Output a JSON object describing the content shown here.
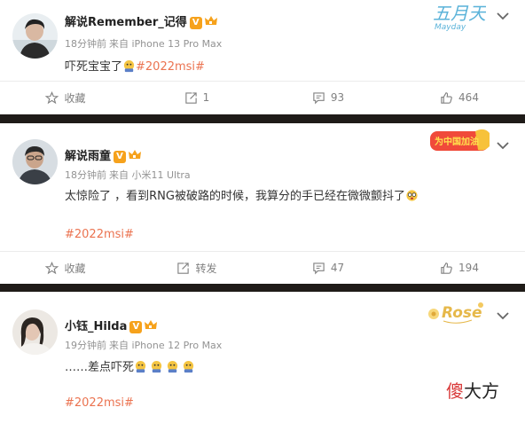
{
  "posts": [
    {
      "username": "解说Remember_记得",
      "v_badge": "V",
      "time": "18分钟前",
      "source": "来自 iPhone 13 Pro Max",
      "text": "吓死宝宝了",
      "hashtag": "#2022msi#",
      "actions": {
        "favorite": "收藏",
        "repost": "1",
        "comment": "93",
        "like": "464"
      },
      "decoration": "五月天 Mayday"
    },
    {
      "username": "解说雨童",
      "v_badge": "V",
      "time": "18分钟前",
      "source": "来自 小米11 Ultra",
      "text": "太惊险了 ，看到RNG被破路的时候，我算分的手已经在微微颤抖了",
      "hashtag": "#2022msi#",
      "actions": {
        "favorite": "收藏",
        "repost": "转发",
        "comment": "47",
        "like": "194"
      },
      "decoration": "为中国加油"
    },
    {
      "username": "小钰_Hilda",
      "v_badge": "V",
      "time": "19分钟前",
      "source": "来自 iPhone 12 Pro Max",
      "text": "……差点吓死",
      "hashtag": "#2022msi#",
      "decoration": "Rose"
    }
  ],
  "watermark": {
    "part1": "傻",
    "part2": "大方"
  },
  "colors": {
    "accent": "#eb7350",
    "separator": "#1f1b18",
    "meta": "#939393",
    "action": "#808080"
  },
  "icons": [
    "chevron-down-icon",
    "star-icon",
    "repost-icon",
    "comment-icon",
    "like-icon",
    "v-verified-icon",
    "vip-crown-icon"
  ]
}
